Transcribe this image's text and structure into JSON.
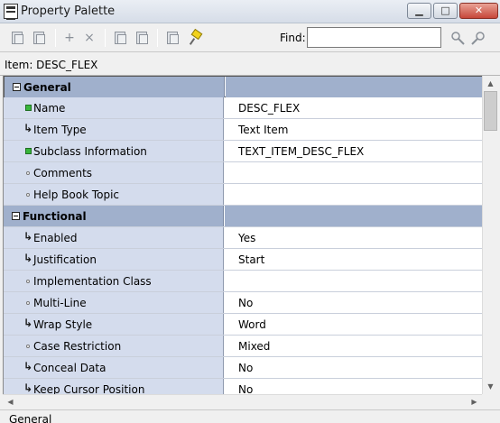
{
  "window": {
    "title": "Property Palette",
    "min_glyph": "▁",
    "max_glyph": "□",
    "close_glyph": "✕"
  },
  "toolbar": {
    "find_label": "Find:",
    "find_value": "",
    "add_glyph": "+",
    "delete_glyph": "×"
  },
  "item_label": "Item: DESC_FLEX",
  "properties": {
    "general": {
      "label": "General",
      "rows": [
        {
          "name": "Name",
          "value": "DESC_FLEX",
          "icon": "green-square"
        },
        {
          "name": "Item Type",
          "value": "Text Item",
          "icon": "inherited-arrow"
        },
        {
          "name": "Subclass Information",
          "value": "TEXT_ITEM_DESC_FLEX",
          "icon": "green-square"
        },
        {
          "name": "Comments",
          "value": "",
          "icon": "default-dot"
        },
        {
          "name": "Help Book Topic",
          "value": "",
          "icon": "default-dot"
        }
      ]
    },
    "functional": {
      "label": "Functional",
      "rows": [
        {
          "name": "Enabled",
          "value": "Yes",
          "icon": "inherited-arrow"
        },
        {
          "name": "Justification",
          "value": "Start",
          "icon": "inherited-arrow"
        },
        {
          "name": "Implementation Class",
          "value": "",
          "icon": "default-dot"
        },
        {
          "name": "Multi-Line",
          "value": "No",
          "icon": "default-dot"
        },
        {
          "name": "Wrap Style",
          "value": "Word",
          "icon": "inherited-arrow"
        },
        {
          "name": "Case Restriction",
          "value": "Mixed",
          "icon": "default-dot"
        },
        {
          "name": "Conceal Data",
          "value": "No",
          "icon": "inherited-arrow"
        },
        {
          "name": "Keep Cursor Position",
          "value": "No",
          "icon": "inherited-arrow"
        }
      ]
    }
  },
  "status": "General"
}
